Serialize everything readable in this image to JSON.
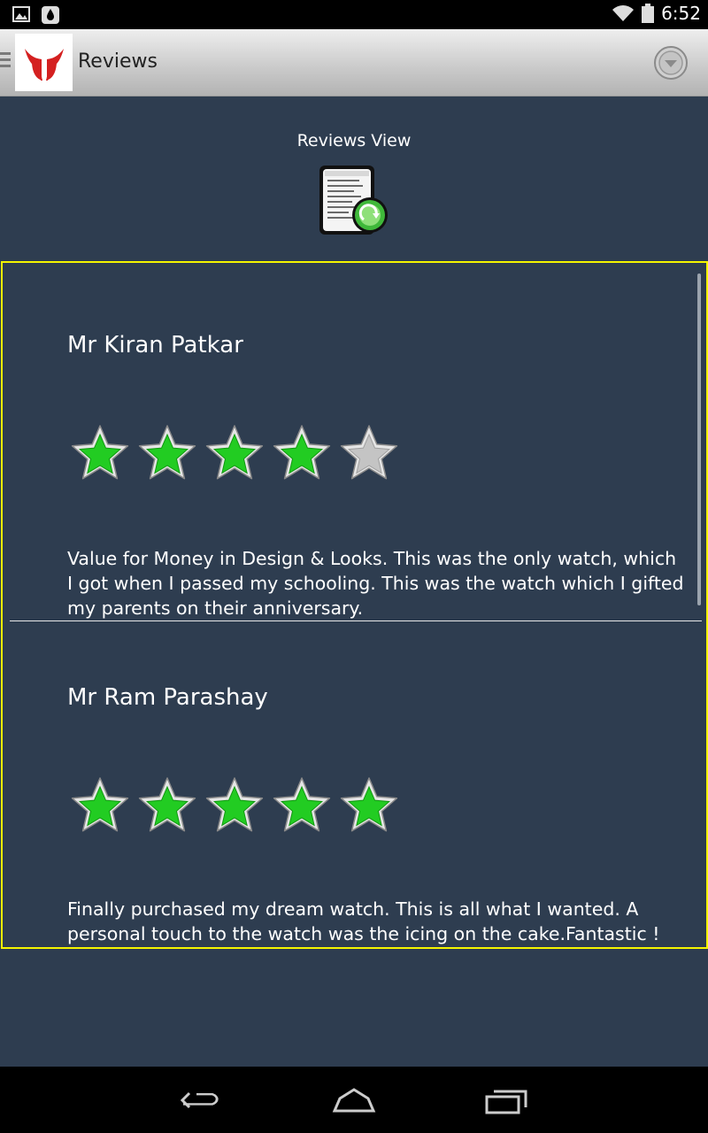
{
  "status_bar": {
    "time": "6:52",
    "left_icons": [
      "gallery-icon",
      "notification-drop-icon"
    ],
    "right_icons": [
      "wifi-icon",
      "battery-icon"
    ]
  },
  "action_bar": {
    "title": "Reviews",
    "logo": "brand-logo",
    "overflow_icon": "chevron-down-circle-icon"
  },
  "header": {
    "view_title": "Reviews View",
    "icon": "document-refresh-icon"
  },
  "reviews": [
    {
      "name": "Mr Kiran Patkar",
      "rating": 4,
      "max_rating": 5,
      "text": "Value for Money in Design & Looks. This was the only watch, which I got when I passed my schooling. This was the watch which I gifted my parents on their anniversary."
    },
    {
      "name": "Mr Ram Parashay",
      "rating": 5,
      "max_rating": 5,
      "text": "Finally purchased my dream watch. This is all what I wanted. A personal touch to the watch was the icing on the cake.Fantastic !"
    }
  ],
  "colors": {
    "background": "#2e3d50",
    "frame_border": "#f5f500",
    "star_filled": "#22cc22",
    "star_empty": "#c4c4c4"
  },
  "nav_bar": {
    "buttons": [
      "back-icon",
      "home-icon",
      "recent-apps-icon"
    ]
  }
}
